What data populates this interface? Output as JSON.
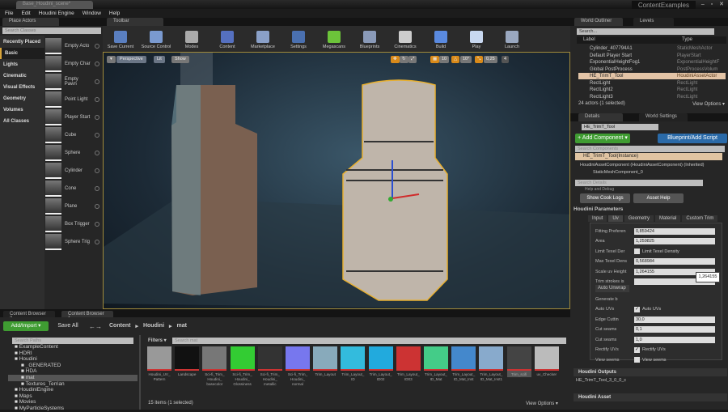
{
  "window": {
    "doc_tab": "Base_Houdini_scene*",
    "title": "ContentExamples",
    "controls": "– ▫ ✕"
  },
  "menu": [
    "File",
    "Edit",
    "Houdini Engine",
    "Window",
    "Help"
  ],
  "place_actors": {
    "tab": "Place Actors",
    "search_placeholder": "Search Classes",
    "categories": [
      "Recently Placed",
      "Basic",
      "Lights",
      "Cinematic",
      "Visual Effects",
      "Geometry",
      "Volumes",
      "All Classes"
    ],
    "selected_category": "Basic",
    "items": [
      "Empty Acto",
      "Empty Char",
      "Empty Pawn",
      "Point Light",
      "Player Start",
      "Cube",
      "Sphere",
      "Cylinder",
      "Cone",
      "Plane",
      "Box Trigger",
      "Sphere Trig"
    ]
  },
  "toolbar": {
    "tab": "Toolbar",
    "buttons": [
      {
        "label": "Save Current",
        "color": "#5a7fc0"
      },
      {
        "label": "Source Control",
        "color": "#7a9ad0"
      },
      {
        "label": "Modes",
        "color": "#aaaaaa"
      },
      {
        "label": "Content",
        "color": "#5570c0"
      },
      {
        "label": "Marketplace",
        "color": "#8aa0c8"
      },
      {
        "label": "Settings",
        "color": "#4a70b0"
      },
      {
        "label": "Megascans",
        "color": "#6cc43a"
      },
      {
        "label": "Blueprints",
        "color": "#8a9ab8"
      },
      {
        "label": "Cinematics",
        "color": "#cccccc"
      },
      {
        "label": "Build",
        "color": "#5a8ae0"
      },
      {
        "label": "Play",
        "color": "#c8d8f0"
      },
      {
        "label": "Launch",
        "color": "#9aa8c0"
      }
    ]
  },
  "viewport": {
    "view_dropdown": "▾",
    "perspective": "Perspective",
    "lit": "Lit",
    "show": "Show",
    "grid_snap": "10",
    "rot_snap": "10°",
    "scale_snap": "0,25",
    "camera_speed": "4"
  },
  "outliner": {
    "tab": "World Outliner",
    "tab2": "Levels",
    "search_placeholder": "Search...",
    "col_label": "Label",
    "col_type": "Type",
    "rows": [
      {
        "label": "Cylinder_407794A1",
        "type": "StaticMeshActor"
      },
      {
        "label": "Default Player Start",
        "type": "PlayerStart"
      },
      {
        "label": "ExponentialHeightFog1",
        "type": "ExponentialHeightF"
      },
      {
        "label": "Global PostProcess",
        "type": "PostProcessVolum"
      },
      {
        "label": "HE_TrimT_Tool",
        "type": "HoudiniAssetActor",
        "selected": true
      },
      {
        "label": "RectLight",
        "type": "RectLight"
      },
      {
        "label": "RectLight2",
        "type": "RectLight"
      },
      {
        "label": "RectLight3",
        "type": "RectLight"
      }
    ],
    "status": "24 actors (1 selected)",
    "view_options": "View Options ▾"
  },
  "details": {
    "tab": "Details",
    "tab2": "World Settings",
    "actor_name": "HE_TrimT_Tool",
    "add_component": "+ Add Component ▾",
    "blueprint": "Blueprint/Add Script",
    "search_components": "Search Components",
    "instance": "HE_TrimT_Tool(Instance)",
    "component": "HoudiniAssetComponent (HoudiniAssetComponent) (Inherited)",
    "sub_component": "StaticMeshComponent_0",
    "search_details": "Search Details",
    "help_debug": "Help and Debug",
    "show_cook_logs": "Show Cook Logs",
    "asset_help": "Asset Help",
    "houdini_params": "Houdini Parameters",
    "param_tabs": [
      "Input",
      "Uv",
      "Geometry",
      "Material",
      "Custom Trim"
    ],
    "active_tab": "Uv",
    "params": [
      {
        "label": "Fitting Preferen",
        "value": "0,859424"
      },
      {
        "label": "Area",
        "value": "1,259825"
      },
      {
        "label": "Limit Texel Der",
        "check": "Limit Texel Density",
        "checked": false
      },
      {
        "label": "Max Texel Dens",
        "value": "0,568984"
      },
      {
        "label": "Scale uv Height",
        "value": "1,264155"
      },
      {
        "label": "Trim strokes is",
        "value": ""
      }
    ],
    "tooltip": "1,264155",
    "auto_unwrap": "Auto Unwrap",
    "unwrap_params": [
      {
        "label": "Generate b"
      },
      {
        "label": "Auto UVs",
        "check": "Auto UVs",
        "checked": true
      },
      {
        "label": "Edge Cuttin",
        "value": "30,0"
      },
      {
        "label": "Cut seams",
        "value": "0,1"
      },
      {
        "label": "Cut seams",
        "value": "1,0"
      },
      {
        "label": "Rectify UVs",
        "check": "Rectify UVs",
        "checked": true
      },
      {
        "label": "View seems",
        "check": "View seems",
        "checked": false
      }
    ],
    "houdini_outputs": "Houdini Outputs",
    "output_item": "HE_TrimT_Tool_3_0_0_c",
    "houdini_asset": "Houdini Asset"
  },
  "content_browser": {
    "tabs": [
      "Content Browser 2",
      "Content Browser 1"
    ],
    "add_import": "Add/Import ▾",
    "save_all": "Save All",
    "breadcrumb": [
      "Content",
      "Houdini",
      "mat"
    ],
    "search_paths": "Search Paths",
    "filters": "Filters ▾",
    "search_assets": "Search mat",
    "tree": [
      {
        "label": "ExampleContent",
        "indent": 1
      },
      {
        "label": "HDRI",
        "indent": 1
      },
      {
        "label": "Houdini",
        "indent": 1,
        "open": true
      },
      {
        "label": "_GENERATED",
        "indent": 2
      },
      {
        "label": "HDA",
        "indent": 2
      },
      {
        "label": "mat",
        "indent": 2,
        "selected": true
      },
      {
        "label": "Textures_Terrian",
        "indent": 2
      },
      {
        "label": "HoudiniEngine",
        "indent": 1
      },
      {
        "label": "Maps",
        "indent": 1
      },
      {
        "label": "Movies",
        "indent": 1
      },
      {
        "label": "MyParticleSystems",
        "indent": 1
      }
    ],
    "assets": [
      {
        "name": "Houdini_UV_ Pattern",
        "color": "#999"
      },
      {
        "name": "Landscape",
        "color": "#111"
      },
      {
        "name": "Sci-fi_Trim_ Houdini_ basecolor",
        "color": "#777"
      },
      {
        "name": "Sci-fi_Trim_ Houdini_ Glossiness",
        "color": "#3c3"
      },
      {
        "name": "Sci-fi_Trim_ Houdini_ metallic",
        "color": "#333"
      },
      {
        "name": "Sci-fi_Trim_ Houdini_ normal",
        "color": "#77e"
      },
      {
        "name": "Trim_Layout",
        "color": "#8ab"
      },
      {
        "name": "Trim_Layout_ ID",
        "color": "#3bd"
      },
      {
        "name": "Trim_Layout_ ID02",
        "color": "#2ad"
      },
      {
        "name": "Trim_Layout_ ID03",
        "color": "#c33"
      },
      {
        "name": "Trim_Layout_ ID_Mat",
        "color": "#4c8"
      },
      {
        "name": "Trim_Layout_ ID_Mat_Inst",
        "color": "#48c"
      },
      {
        "name": "Trim_Layout_ ID_Mat_Inst1",
        "color": "#8ac"
      },
      {
        "name": "Trim_scifi",
        "color": "#444",
        "selected": true
      },
      {
        "name": "uv_Checker",
        "color": "#bbb"
      }
    ],
    "status": "15 items (1 selected)",
    "view_options": "View Options ▾"
  }
}
